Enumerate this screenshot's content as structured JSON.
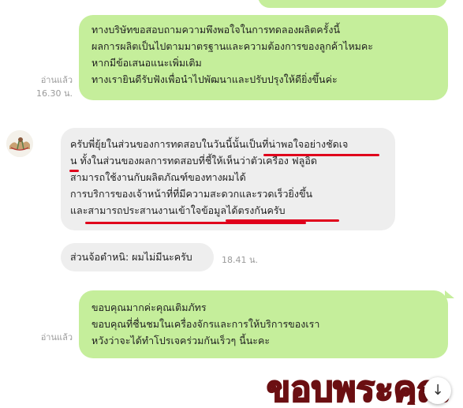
{
  "messages": [
    {
      "id": "m0",
      "direction": "outgoing",
      "text": ""
    },
    {
      "id": "m1",
      "direction": "outgoing",
      "lines": [
        "ทางบริษัทขอสอบถามความพึงพอใจในการทดลองผลิตครั้งนี้",
        "ผลการผลิตเป็นไปตามมาตรฐานและความต้องการของลูกค้าไหมคะ",
        "หากมีข้อเสนอแนะเพิ่มเติม",
        "ทางเรายินดีรับฟังเพื่อนำไปพัฒนาและปรับปรุงให้ดียิ่งขึ้นค่ะ"
      ],
      "read_label": "อ่านแล้ว",
      "time": "16.30 น."
    },
    {
      "id": "m2",
      "direction": "incoming",
      "lines": [
        "ครับพี่ยุ้ยในส่วนของการทดสอบในวันนี้นั้นเป็นที่น่าพอใจอย่างชัดเจ",
        "น ทั้งในส่วนของผลการทดสอบที่ชี้ให้เห็นว่าตัวเครื่อง  ฟลูอิด",
        "สามารถใช้งานกับผลิตภัณฑ์ของทางผมได้",
        "การบริการของเจ้าหน้าที่ที่มีความสะดวกและรวดเร็วยิ่งขึ้น",
        "และสามารถประสานงานเข้าใจข้อมูลได้ตรงกันครับ"
      ]
    },
    {
      "id": "m3",
      "direction": "incoming",
      "lines": [
        "ส่วนจ้อตำหนิ: ผมไม่มีนะครับ"
      ],
      "time": "18.41 น."
    },
    {
      "id": "m4",
      "direction": "outgoing",
      "lines": [
        "ขอบคุณมากค่ะคุณเติมภัทร",
        "ขอบคุณที่ชื่นชมในเครื่องจักรและการให้บริการของเรา",
        "หวังว่าจะได้ทำโปรเจคร่วมกันเร็วๆ นี้นะคะ"
      ],
      "read_label": "อ่านแล้ว"
    }
  ],
  "sticker": {
    "text": "ขอบพระคุณ",
    "color": "#6b0f12"
  },
  "scroll_button": {
    "icon": "arrow-down-icon",
    "glyph": "↓"
  },
  "colors": {
    "outgoing_bubble": "#c5ee9b",
    "incoming_bubble": "#eeeeee",
    "highlight_underline": "#e0001b"
  }
}
